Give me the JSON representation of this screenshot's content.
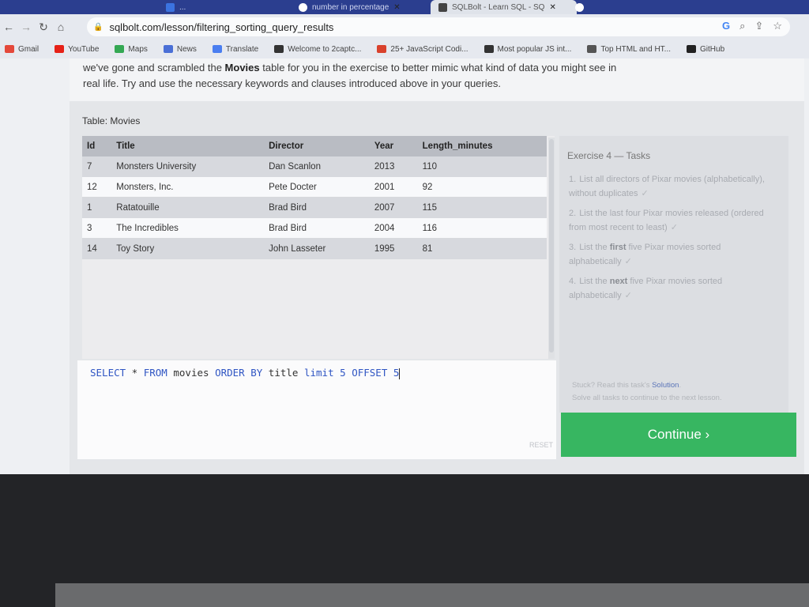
{
  "browser": {
    "tabs": [
      {
        "label": "...",
        "icon": "app-icon"
      },
      {
        "label": "number in percentage",
        "icon": "google-icon"
      },
      {
        "label": "SQLBolt - Learn SQL - SQ",
        "icon": "sqlbolt-icon",
        "active": true
      },
      {
        "label": "",
        "icon": "google-icon"
      }
    ],
    "url": "sqlbolt.com/lesson/filtering_sorting_query_results",
    "bookmarks": [
      {
        "label": "Gmail",
        "color": "#e4483a"
      },
      {
        "label": "YouTube",
        "color": "#e62117"
      },
      {
        "label": "Maps",
        "color": "#34a853"
      },
      {
        "label": "News",
        "color": "#4a6fd6"
      },
      {
        "label": "Translate",
        "color": "#4a7ef0"
      },
      {
        "label": "Welcome to 2captc...",
        "color": "#333333"
      },
      {
        "label": "25+ JavaScript Codi...",
        "color": "#d9412c"
      },
      {
        "label": "Most popular JS int...",
        "color": "#333333"
      },
      {
        "label": "Top HTML and HT...",
        "color": "#555555"
      },
      {
        "label": "GitHub",
        "color": "#222222"
      }
    ]
  },
  "lesson": {
    "intro_part1": "we've gone and scrambled the ",
    "intro_bold": "Movies",
    "intro_part2": " table for you in the exercise to better mimic what kind of data you might see in real life. Try and use the necessary keywords and clauses introduced above in your queries."
  },
  "table": {
    "label": "Table: Movies",
    "columns": [
      "Id",
      "Title",
      "Director",
      "Year",
      "Length_minutes"
    ],
    "rows": [
      [
        "7",
        "Monsters University",
        "Dan Scanlon",
        "2013",
        "110"
      ],
      [
        "12",
        "Monsters, Inc.",
        "Pete Docter",
        "2001",
        "92"
      ],
      [
        "1",
        "Ratatouille",
        "Brad Bird",
        "2007",
        "115"
      ],
      [
        "3",
        "The Incredibles",
        "Brad Bird",
        "2004",
        "116"
      ],
      [
        "14",
        "Toy Story",
        "John Lasseter",
        "1995",
        "81"
      ]
    ]
  },
  "editor": {
    "tokens": [
      {
        "t": "SELECT",
        "k": "kw"
      },
      {
        "t": " * ",
        "k": "plain"
      },
      {
        "t": "FROM",
        "k": "kw"
      },
      {
        "t": " movies ",
        "k": "plain"
      },
      {
        "t": "ORDER BY",
        "k": "kw"
      },
      {
        "t": " title ",
        "k": "plain"
      },
      {
        "t": "limit",
        "k": "kw"
      },
      {
        "t": " ",
        "k": "plain"
      },
      {
        "t": "5",
        "k": "num"
      },
      {
        "t": " ",
        "k": "plain"
      },
      {
        "t": "OFFSET",
        "k": "kw"
      },
      {
        "t": " ",
        "k": "plain"
      },
      {
        "t": "5",
        "k": "num"
      }
    ],
    "reset_label": "RESET"
  },
  "tasks": {
    "title": "Exercise 4 — Tasks",
    "items": [
      {
        "num": "1.",
        "pre": "List all directors of Pixar movies (alphabetically), without duplicates",
        "bold": "",
        "post": "",
        "check": "✓"
      },
      {
        "num": "2.",
        "pre": "List the last four Pixar movies released (ordered from most recent to least)",
        "bold": "",
        "post": "",
        "check": "✓"
      },
      {
        "num": "3.",
        "pre": "List the ",
        "bold": "first",
        "post": " five Pixar movies sorted alphabetically",
        "check": "✓"
      },
      {
        "num": "4.",
        "pre": "List the ",
        "bold": "next",
        "post": " five Pixar movies sorted alphabetically",
        "check": "✓"
      }
    ],
    "stuck_text": "Stuck? Read this task's ",
    "solution_link": "Solution",
    "stuck_end": ".",
    "solve_all": "Solve all tasks to continue to the next lesson."
  },
  "continue_label": "Continue ›"
}
